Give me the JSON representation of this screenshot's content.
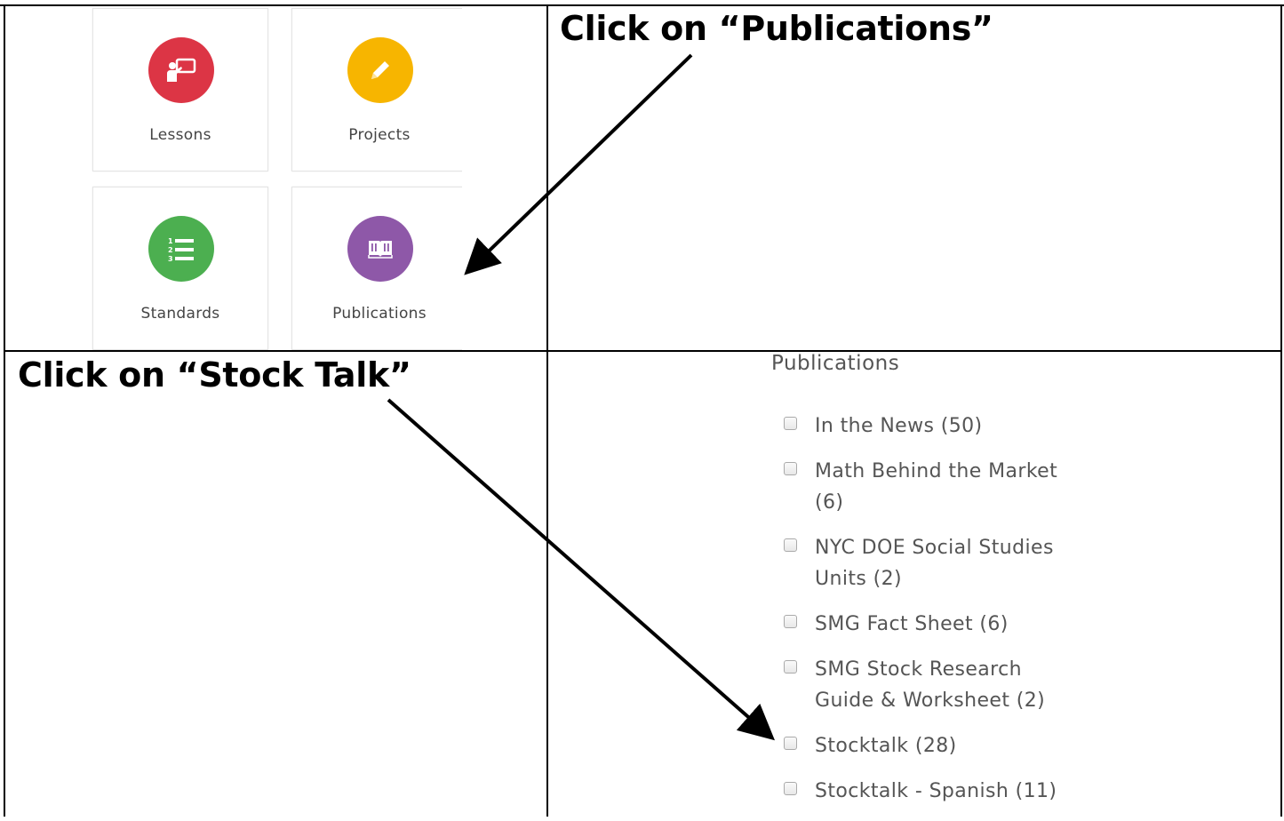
{
  "tiles": [
    {
      "label": "Lessons",
      "color": "#dc3545",
      "icon": "teacher-board-icon"
    },
    {
      "label": "Projects",
      "color": "#f7b500",
      "icon": "pencil-icon"
    },
    {
      "label": "Standards",
      "color": "#4caf50",
      "icon": "numbered-list-icon"
    },
    {
      "label": "Publications",
      "color": "#8e58a8",
      "icon": "open-book-icon"
    }
  ],
  "instructions": {
    "publications": "Click on  “Publications”",
    "stocktalk": "Click on “Stock Talk”"
  },
  "publications_panel": {
    "heading": "Publications",
    "items": [
      {
        "label": "In the News (50)"
      },
      {
        "label": "Math Behind the Market (6)"
      },
      {
        "label": "NYC DOE Social Studies Units (2)"
      },
      {
        "label": "SMG Fact Sheet (6)"
      },
      {
        "label": "SMG Stock Research Guide & Worksheet (2)"
      },
      {
        "label": "Stocktalk (28)"
      },
      {
        "label": "Stocktalk - Spanish (11)"
      }
    ]
  },
  "colors": {
    "border": "#000000",
    "text_muted": "#555555"
  }
}
